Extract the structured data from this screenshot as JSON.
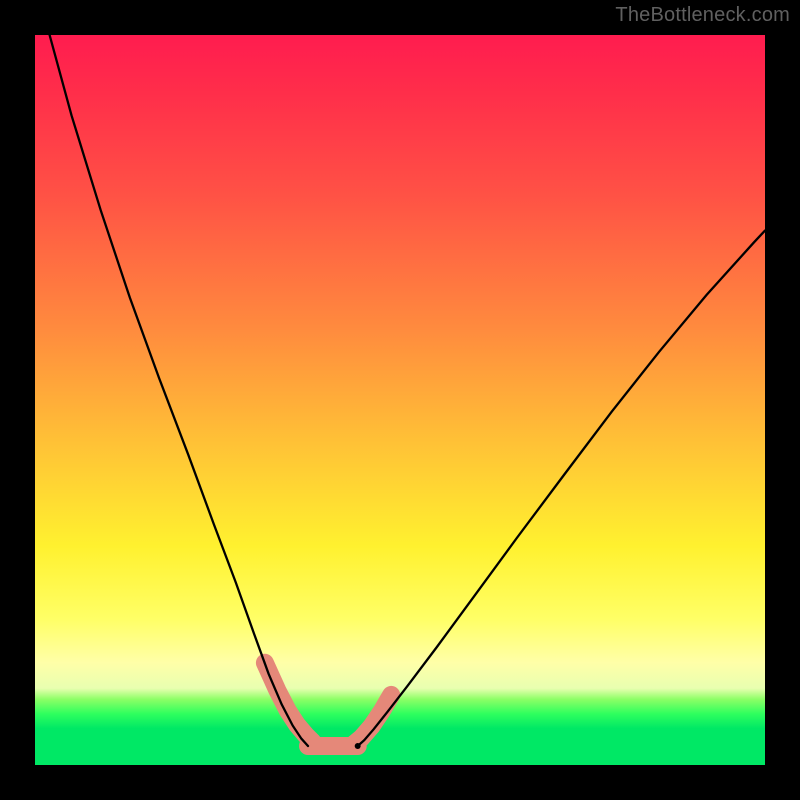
{
  "watermark": "TheBottleneck.com",
  "chart_data": {
    "type": "line",
    "title": "",
    "xlabel": "",
    "ylabel": "",
    "xlim": [
      0,
      100
    ],
    "ylim": [
      0,
      100
    ],
    "grid": false,
    "legend": false,
    "notes": "Axes and ticks are not labeled in the source image; x and y are expressed as 0–100 percentages of the plot area (x left→right, y bottom→top). Background is a vertical red→yellow→green gradient. Two black curves form a V shape; thick salmon segments highlight each curve near the bottom plus a flat salmon segment along the trough.",
    "series": [
      {
        "name": "left-curve",
        "x": [
          2,
          5,
          9,
          13,
          17,
          21,
          24.5,
          27.5,
          30,
          32,
          33.8,
          35.3,
          36.5,
          37.4
        ],
        "y": [
          100,
          89,
          76,
          64,
          53,
          42.5,
          33,
          25,
          18,
          12.5,
          8.3,
          5.4,
          3.6,
          2.6
        ]
      },
      {
        "name": "right-curve",
        "x": [
          44.2,
          45.1,
          46.4,
          48.3,
          51,
          55,
          60,
          66,
          72.5,
          79,
          85.5,
          92,
          98.5,
          100
        ],
        "y": [
          2.6,
          3.4,
          4.9,
          7.3,
          10.8,
          16.1,
          22.9,
          31.1,
          39.8,
          48.4,
          56.6,
          64.4,
          71.6,
          73.2
        ]
      }
    ],
    "highlights": [
      {
        "name": "left-thick-segment",
        "x": [
          31.5,
          33.2,
          34.6,
          35.9,
          37.1,
          38.0
        ],
        "y": [
          14.0,
          10.2,
          7.5,
          5.5,
          4.1,
          3.2
        ]
      },
      {
        "name": "bottom-flat-segment",
        "x": [
          37.4,
          44.2
        ],
        "y": [
          2.6,
          2.6
        ]
      },
      {
        "name": "right-thick-segment",
        "x": [
          43.6,
          44.7,
          46.1,
          47.5,
          48.8
        ],
        "y": [
          2.8,
          3.7,
          5.3,
          7.4,
          9.6
        ]
      }
    ],
    "dot": {
      "x": 44.2,
      "y": 2.6
    },
    "gradient_stops": [
      {
        "pos": 0,
        "color": "#ff1c4f"
      },
      {
        "pos": 0.22,
        "color": "#ff5245"
      },
      {
        "pos": 0.4,
        "color": "#ff8a3e"
      },
      {
        "pos": 0.7,
        "color": "#fff12f"
      },
      {
        "pos": 0.9,
        "color": "#e8ffb0"
      },
      {
        "pos": 0.95,
        "color": "#00e865"
      },
      {
        "pos": 1.0,
        "color": "#00e865"
      }
    ]
  }
}
